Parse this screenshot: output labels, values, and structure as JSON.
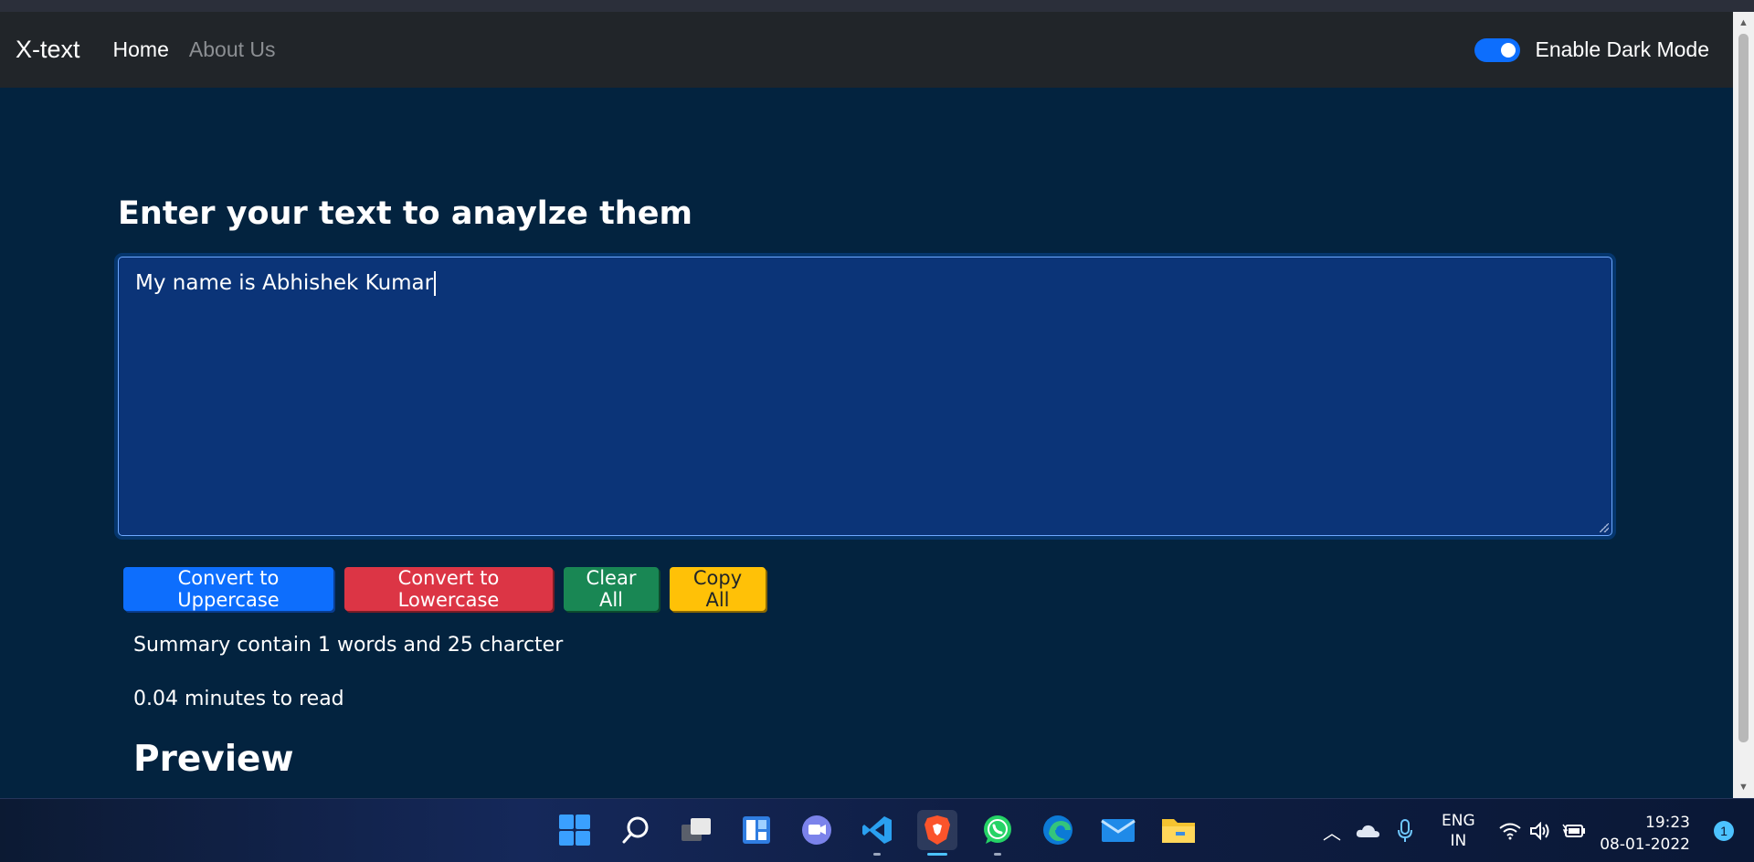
{
  "navbar": {
    "brand": "X-text",
    "links": [
      "Home",
      "About Us"
    ],
    "dark_mode_label": "Enable Dark Mode",
    "dark_mode_on": true
  },
  "form": {
    "heading": "Enter your text to anaylze them",
    "text_value": "My name is Abhishek Kumar"
  },
  "buttons": {
    "uppercase": "Convert to Uppercase",
    "lowercase": "Convert to Lowercase",
    "clear": "Clear All",
    "copy": "Copy All"
  },
  "summary": {
    "stats": "Summary contain 1 words and 25 charcter",
    "read_time": "0.04 minutes to read",
    "preview_heading": "Preview"
  },
  "taskbar": {
    "apps": [
      "start-icon",
      "search-icon",
      "task-view-icon",
      "widgets-icon",
      "teams-chat-icon",
      "vscode-icon",
      "brave-browser-icon",
      "whatsapp-icon",
      "edge-icon",
      "mail-icon",
      "file-explorer-icon"
    ],
    "language_line1": "ENG",
    "language_line2": "IN",
    "time": "19:23",
    "date": "08-01-2022",
    "notification_count": "1"
  },
  "colors": {
    "page_bg": "#03233f",
    "navbar_bg": "#212529",
    "textarea_bg": "#0b3478",
    "primary": "#0d6efd",
    "danger": "#dc3545",
    "success": "#198754",
    "warning": "#ffc107"
  }
}
